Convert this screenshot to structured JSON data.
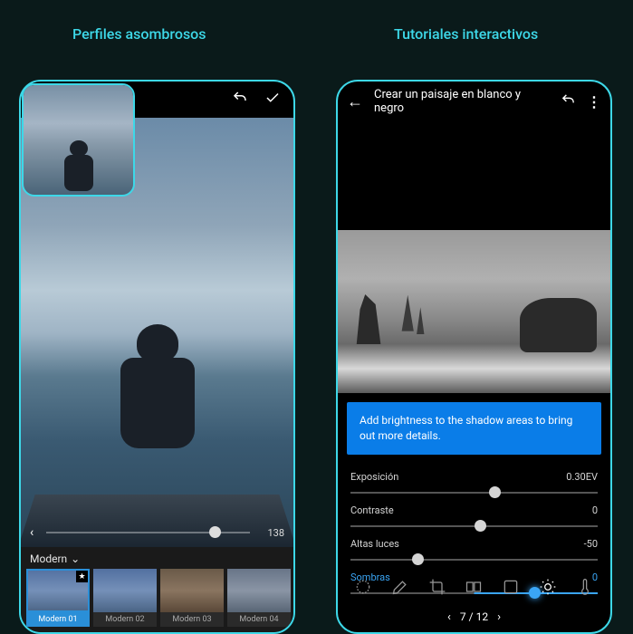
{
  "titles": {
    "left": "Perfiles asombrosos",
    "right": "Tutoriales interactivos"
  },
  "left": {
    "intensity_value": "138",
    "preset_group": "Modern",
    "presets": [
      {
        "name": "Modern 01",
        "selected": true,
        "star": true
      },
      {
        "name": "Modern 02",
        "selected": false,
        "star": false
      },
      {
        "name": "Modern 03",
        "selected": false,
        "star": false
      },
      {
        "name": "Modern 04",
        "selected": false,
        "star": false
      }
    ]
  },
  "right": {
    "tutorial_title": "Crear un paisaje en blanco y negro",
    "tooltip": "Add brightness to the shadow areas to bring out more details.",
    "sliders": [
      {
        "label": "Exposición",
        "value": "0.30EV",
        "pos": 56
      },
      {
        "label": "Contraste",
        "value": "0",
        "pos": 50
      },
      {
        "label": "Altas luces",
        "value": "-50",
        "pos": 25
      },
      {
        "label": "Sombras",
        "value": "0",
        "pos": 72,
        "active": true
      }
    ],
    "pager": {
      "current": "7",
      "total": "12",
      "display": "7 / 12"
    }
  }
}
